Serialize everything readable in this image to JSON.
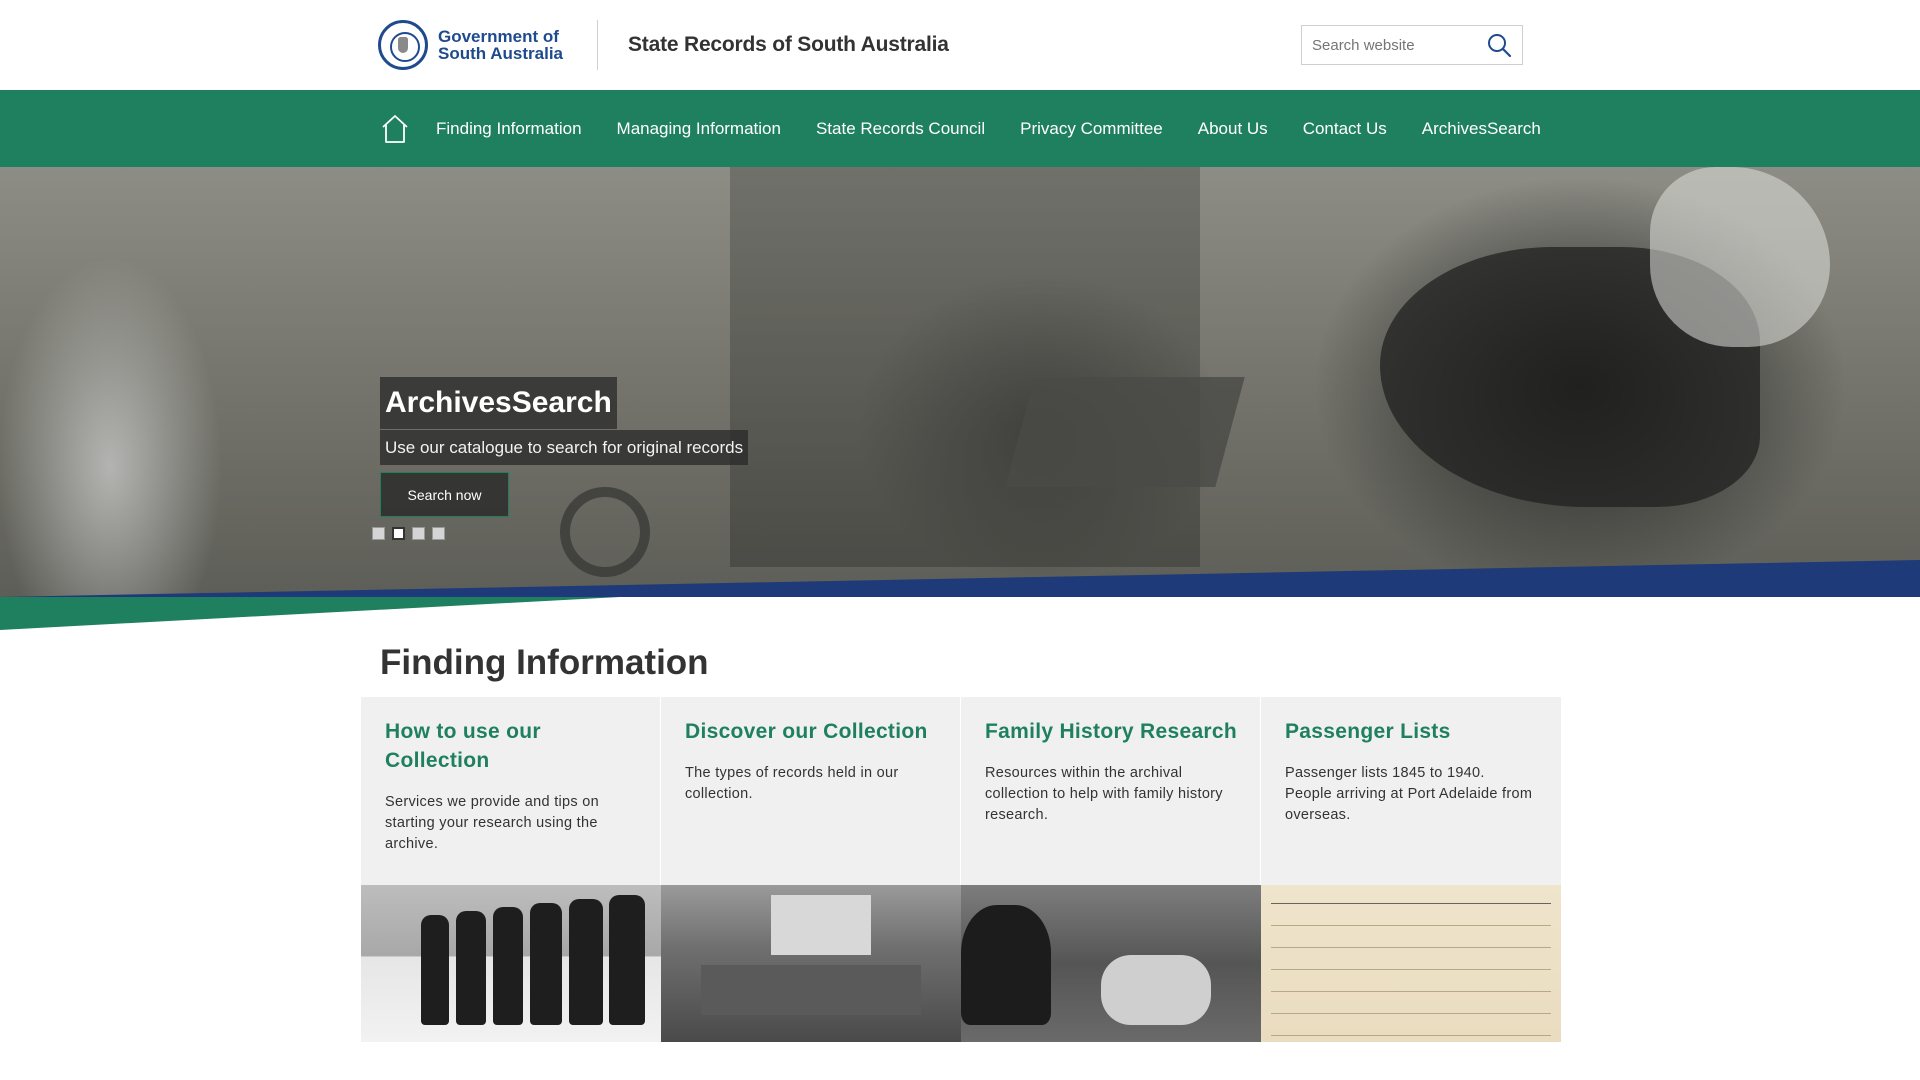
{
  "header": {
    "logo_line1": "Government of",
    "logo_line2": "South Australia",
    "site_title": "State Records of South Australia",
    "search_placeholder": "Search website"
  },
  "nav": {
    "items": [
      {
        "label": "Finding Information"
      },
      {
        "label": "Managing Information"
      },
      {
        "label": "State Records Council"
      },
      {
        "label": "Privacy Committee"
      },
      {
        "label": "About Us"
      },
      {
        "label": "Contact Us"
      },
      {
        "label": "ArchivesSearch"
      }
    ]
  },
  "hero": {
    "title": "ArchivesSearch",
    "subtitle": "Use our catalogue to search for original records",
    "button": "Search now",
    "slides": 4,
    "active_slide": 2
  },
  "colors": {
    "brand_green": "#1f8060",
    "brand_blue": "#1f3a78",
    "gov_blue": "#1f4b8e"
  },
  "finding": {
    "title": "Finding Information",
    "cards": [
      {
        "title": "How to use our Collection",
        "desc": "Services we provide and tips on starting your research using the archive."
      },
      {
        "title": "Discover our Collection",
        "desc": "The types of records held in our collection."
      },
      {
        "title": "Family History Research",
        "desc": "Resources within the archival collection to help with family history research."
      },
      {
        "title": "Passenger Lists",
        "desc": "Passenger lists 1845 to 1940. People arriving at Port Adelaide from overseas."
      }
    ]
  }
}
